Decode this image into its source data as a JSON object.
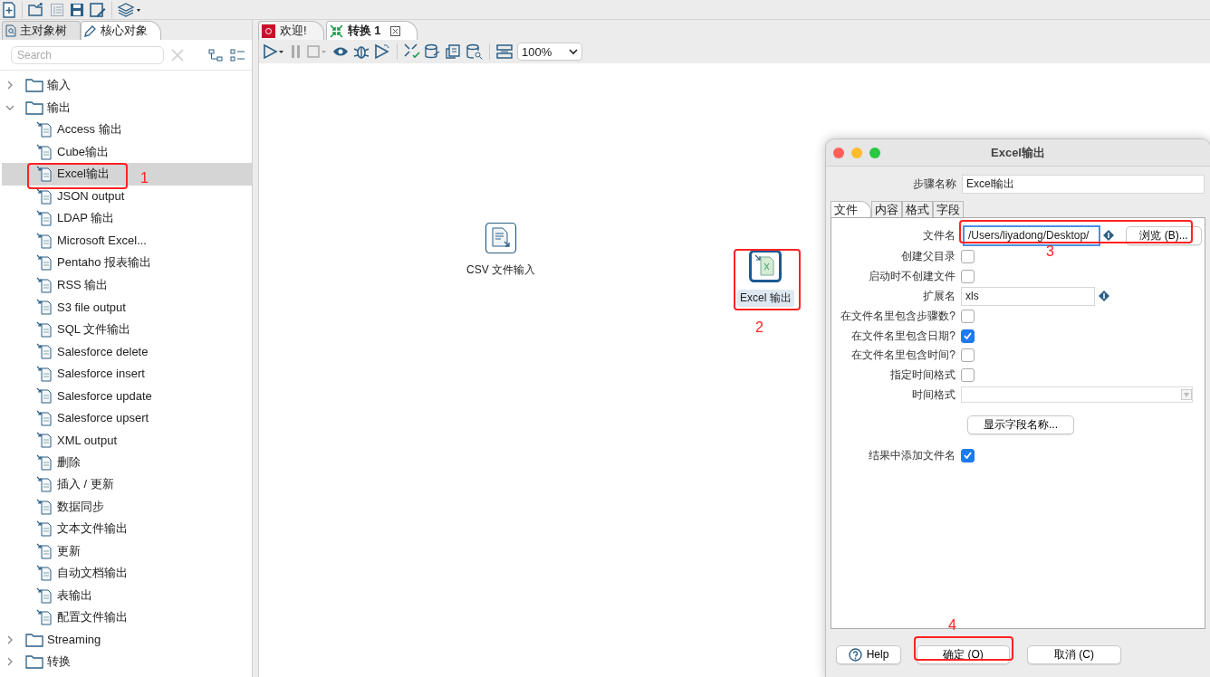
{
  "left_panel": {
    "tabs": [
      {
        "label": "主对象树",
        "selected": false
      },
      {
        "label": "核心对象",
        "selected": true
      }
    ],
    "search": {
      "placeholder": "Search"
    },
    "tree": [
      {
        "label": "输入",
        "expanded": false
      },
      {
        "label": "输出",
        "expanded": true,
        "children": [
          {
            "label": "Access 输出",
            "selected": false
          },
          {
            "label": "Cube输出",
            "selected": false
          },
          {
            "label": "Excel输出",
            "selected": true
          },
          {
            "label": "JSON output",
            "selected": false
          },
          {
            "label": "LDAP 输出",
            "selected": false
          },
          {
            "label": "Microsoft Excel...",
            "selected": false
          },
          {
            "label": "Pentaho 报表输出",
            "selected": false
          },
          {
            "label": "RSS 输出",
            "selected": false
          },
          {
            "label": "S3 file output",
            "selected": false
          },
          {
            "label": "SQL 文件输出",
            "selected": false
          },
          {
            "label": "Salesforce delete",
            "selected": false
          },
          {
            "label": "Salesforce insert",
            "selected": false
          },
          {
            "label": "Salesforce update",
            "selected": false
          },
          {
            "label": "Salesforce upsert",
            "selected": false
          },
          {
            "label": "XML output",
            "selected": false
          },
          {
            "label": "删除",
            "selected": false
          },
          {
            "label": "插入 / 更新",
            "selected": false
          },
          {
            "label": "数据同步",
            "selected": false
          },
          {
            "label": "文本文件输出",
            "selected": false
          },
          {
            "label": "更新",
            "selected": false
          },
          {
            "label": "自动文档输出",
            "selected": false
          },
          {
            "label": "表输出",
            "selected": false
          },
          {
            "label": "配置文件输出",
            "selected": false
          }
        ]
      },
      {
        "label": "Streaming",
        "expanded": false
      },
      {
        "label": "转换",
        "expanded": false
      }
    ]
  },
  "editor_tabs": [
    {
      "label": "欢迎!",
      "selected": false,
      "closable": false
    },
    {
      "label": "转换 1",
      "selected": true,
      "closable": true
    }
  ],
  "canvas_toolbar": {
    "zoom": "100%"
  },
  "canvas_steps": [
    {
      "label": "CSV 文件输入",
      "selected": false
    },
    {
      "label": "Excel 输出",
      "selected": true
    }
  ],
  "dialog": {
    "title": "Excel输出",
    "step_name_label": "步骤名称",
    "step_name": "Excel输出",
    "tabs": [
      {
        "label": "文件",
        "selected": true
      },
      {
        "label": "内容",
        "selected": false
      },
      {
        "label": "格式",
        "selected": false
      },
      {
        "label": "字段",
        "selected": false
      }
    ],
    "fields": [
      {
        "kind": "file",
        "label": "文件名",
        "value": "/Users/liyadong/Desktop/",
        "button": "浏览 (B)..."
      },
      {
        "kind": "checkbox",
        "label": "创建父目录",
        "checked": false
      },
      {
        "kind": "checkbox",
        "label": "启动时不创建文件",
        "checked": false
      },
      {
        "kind": "text",
        "label": "扩展名",
        "value": "xls"
      },
      {
        "kind": "checkbox",
        "label": "在文件名里包含步骤数?",
        "checked": false
      },
      {
        "kind": "checkbox",
        "label": "在文件名里包含日期?",
        "checked": true
      },
      {
        "kind": "checkbox",
        "label": "在文件名里包含时间?",
        "checked": false
      },
      {
        "kind": "checkbox",
        "label": "指定时间格式",
        "checked": false
      },
      {
        "kind": "select",
        "label": "时间格式"
      },
      {
        "kind": "button",
        "button": "显示字段名称..."
      },
      {
        "kind": "checkbox",
        "label": "结果中添加文件名",
        "checked": true
      }
    ],
    "buttons": [
      {
        "kind": "help",
        "label": "Help"
      },
      {
        "kind": "ok",
        "label": "确定 (O)"
      },
      {
        "kind": "cancel",
        "label": "取消 (C)"
      }
    ]
  },
  "annotations": [
    {
      "label": "1"
    },
    {
      "label": "2"
    },
    {
      "label": "3"
    },
    {
      "label": "4"
    }
  ]
}
